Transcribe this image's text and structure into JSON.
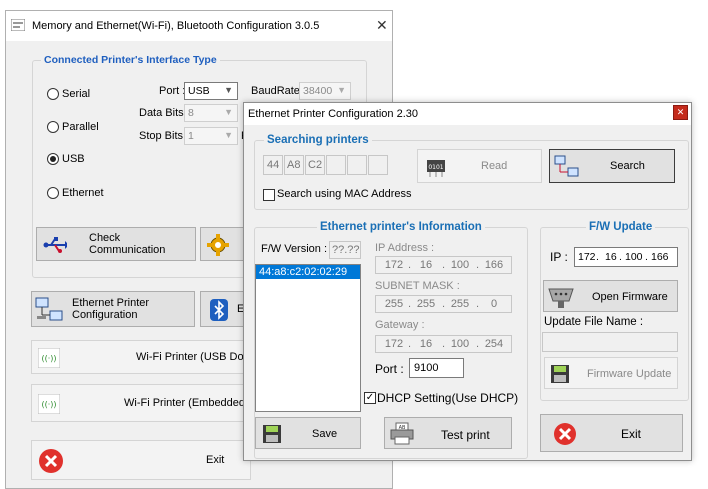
{
  "main_window": {
    "title": "Memory and Ethernet(Wi-Fi), Bluetooth Configuration 3.0.5",
    "interface_group": {
      "title": "Connected Printer's Interface Type",
      "radios": [
        "Serial",
        "Parallel",
        "USB",
        "Ethernet"
      ],
      "selected": "USB",
      "port_label": "Port :",
      "port_value": "USB",
      "baud_label": "BaudRate :",
      "baud_value": "38400",
      "databits_label": "Data Bits :",
      "databits_value": "8",
      "stopbits_label": "Stop Bits :",
      "stopbits_value": "1",
      "check_comm_label": "Check Communication"
    },
    "ethernet_config_label": "Ethernet Printer Configuration",
    "wifi_usb_label": "Wi-Fi Printer (USB Dongle) Co",
    "wifi_embedded_label": "Wi-Fi Printer (Embedded Module",
    "exit_label": "Exit",
    "partial_b": "E",
    "partial_p": "P"
  },
  "dialog": {
    "title": "Ethernet Printer Configuration 2.30",
    "searching": {
      "title": "Searching printers",
      "mac_cells": [
        "44",
        "A8",
        "C2",
        "",
        "",
        ""
      ],
      "read_label": "Read",
      "search_label": "Search",
      "mac_checkbox_label": "Search using MAC Address"
    },
    "info": {
      "title": "Ethernet printer's Information",
      "fw_version_label": "F/W Version :",
      "fw_version_value": "??.??",
      "list_item": "44:a8:c2:02:02:29",
      "ip_label": "IP Address :",
      "ip": [
        "172",
        "16",
        "100",
        "166"
      ],
      "subnet_label": "SUBNET MASK :",
      "subnet": [
        "255",
        "255",
        "255",
        "0"
      ],
      "gateway_label": "Gateway :",
      "gateway": [
        "172",
        "16",
        "100",
        "254"
      ],
      "port_label": "Port :",
      "port_value": "9100",
      "dhcp_label": "DHCP Setting(Use DHCP)",
      "dhcp_checked": true
    },
    "fw_update": {
      "title": "F/W Update",
      "ip_label": "IP :",
      "ip": [
        "172",
        "16",
        "100",
        "166"
      ],
      "open_firmware_label": "Open Firmware",
      "update_file_label": "Update File Name :",
      "update_file_value": "",
      "firmware_update_label": "Firmware Update"
    },
    "save_label": "Save",
    "test_print_label": "Test print",
    "exit_label": "Exit"
  }
}
